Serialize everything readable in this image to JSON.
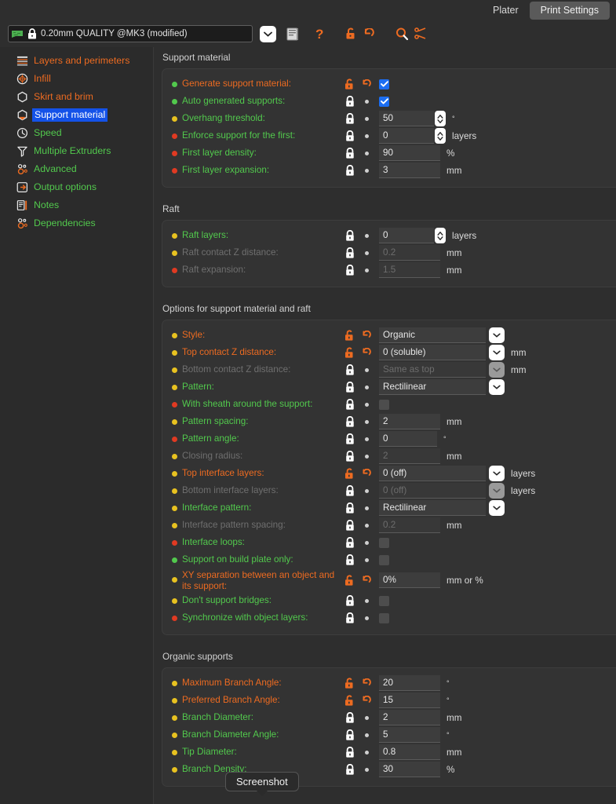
{
  "tabs": [
    {
      "label": "Plater",
      "active": false
    },
    {
      "label": "Print Settings",
      "active": true
    }
  ],
  "toolbar": {
    "preset_value": "0.20mm QUALITY @MK3 (modified)",
    "icons": [
      "printer-flag-icon",
      "lock-icon",
      "chevron-down-icon",
      "save-icon",
      "question-icon",
      "unlock-icon",
      "undo-icon",
      "search-icon",
      "compare-icon"
    ]
  },
  "sidebar": {
    "items": [
      {
        "label": "Layers and perimeters",
        "icon": "layers-icon",
        "color": "#ed6b21",
        "selected": false
      },
      {
        "label": "Infill",
        "icon": "infill-icon",
        "color": "#ed6b21",
        "selected": false
      },
      {
        "label": "Skirt and brim",
        "icon": "skirt-icon",
        "color": "#ed6b21",
        "selected": false
      },
      {
        "label": "Support material",
        "icon": "support-icon",
        "color": "#ffffff",
        "selected": true
      },
      {
        "label": "Speed",
        "icon": "speed-icon",
        "color": "#52c94d",
        "selected": false
      },
      {
        "label": "Multiple Extruders",
        "icon": "extruder-icon",
        "color": "#52c94d",
        "selected": false
      },
      {
        "label": "Advanced",
        "icon": "advanced-icon",
        "color": "#52c94d",
        "selected": false
      },
      {
        "label": "Output options",
        "icon": "output-icon",
        "color": "#52c94d",
        "selected": false
      },
      {
        "label": "Notes",
        "icon": "notes-icon",
        "color": "#52c94d",
        "selected": false
      },
      {
        "label": "Dependencies",
        "icon": "deps-icon",
        "color": "#52c94d",
        "selected": false
      }
    ]
  },
  "sections": [
    {
      "title": "Support material",
      "rows": [
        {
          "label": "Generate support material:",
          "dot": "green",
          "label_color": "orange",
          "modified": true,
          "control": "checkbox",
          "checked": true
        },
        {
          "label": "Auto generated supports:",
          "dot": "green",
          "label_color": "green",
          "modified": false,
          "control": "checkbox",
          "checked": true
        },
        {
          "label": "Overhang threshold:",
          "dot": "yellow",
          "label_color": "green",
          "modified": false,
          "control": "spinner",
          "value": "50",
          "unit": "°",
          "width": "w70"
        },
        {
          "label": "Enforce support for the first:",
          "dot": "red",
          "label_color": "green",
          "modified": false,
          "control": "spinner",
          "value": "0",
          "unit": "layers",
          "width": "w70"
        },
        {
          "label": "First layer density:",
          "dot": "red",
          "label_color": "green",
          "modified": false,
          "control": "text",
          "value": "90",
          "unit": "%",
          "width": "w78"
        },
        {
          "label": "First layer expansion:",
          "dot": "red",
          "label_color": "green",
          "modified": false,
          "control": "text",
          "value": "3",
          "unit": "mm",
          "width": "w78"
        }
      ]
    },
    {
      "title": "Raft",
      "rows": [
        {
          "label": "Raft layers:",
          "dot": "yellow",
          "label_color": "green",
          "modified": false,
          "control": "spinner",
          "value": "0",
          "unit": "layers",
          "width": "w70"
        },
        {
          "label": "Raft contact Z distance:",
          "dot": "yellow",
          "label_color": "green",
          "modified": false,
          "control": "text",
          "value": "0.2",
          "unit": "mm",
          "width": "w78",
          "disabled": true
        },
        {
          "label": "Raft expansion:",
          "dot": "red",
          "label_color": "green",
          "modified": false,
          "control": "text",
          "value": "1.5",
          "unit": "mm",
          "width": "w78",
          "disabled": true
        }
      ]
    },
    {
      "title": "Options for support material and raft",
      "rows": [
        {
          "label": "Style:",
          "dot": "yellow",
          "label_color": "orange",
          "modified": true,
          "control": "dropdown",
          "value": "Organic",
          "unit": "",
          "width": "w136"
        },
        {
          "label": "Top contact Z distance:",
          "dot": "yellow",
          "label_color": "orange",
          "modified": true,
          "control": "dropdown",
          "value": "0 (soluble)",
          "unit": "mm",
          "width": "w136"
        },
        {
          "label": "Bottom contact Z distance:",
          "dot": "yellow",
          "label_color": "green",
          "modified": false,
          "control": "dropdown",
          "value": "Same as top",
          "unit": "mm",
          "width": "w136",
          "disabled": true
        },
        {
          "label": "Pattern:",
          "dot": "yellow",
          "label_color": "green",
          "modified": false,
          "control": "dropdown",
          "value": "Rectilinear",
          "unit": "",
          "width": "w136"
        },
        {
          "label": "With sheath around the support:",
          "dot": "red",
          "label_color": "green",
          "modified": false,
          "control": "checkbox",
          "checked": false
        },
        {
          "label": "Pattern spacing:",
          "dot": "yellow",
          "label_color": "green",
          "modified": false,
          "control": "text",
          "value": "2",
          "unit": "mm",
          "width": "w78"
        },
        {
          "label": "Pattern angle:",
          "dot": "red",
          "label_color": "green",
          "modified": false,
          "control": "text",
          "value": "0",
          "unit": "°",
          "width": "w74"
        },
        {
          "label": "Closing radius:",
          "dot": "yellow",
          "label_color": "green",
          "modified": false,
          "control": "text",
          "value": "2",
          "unit": "mm",
          "width": "w78",
          "disabled": true
        },
        {
          "label": "Top interface layers:",
          "dot": "yellow",
          "label_color": "orange",
          "modified": true,
          "control": "dropdown",
          "value": "0 (off)",
          "unit": "layers",
          "width": "w136"
        },
        {
          "label": "Bottom interface layers:",
          "dot": "yellow",
          "label_color": "green",
          "modified": false,
          "control": "dropdown",
          "value": "0 (off)",
          "unit": "layers",
          "width": "w136",
          "disabled": true
        },
        {
          "label": "Interface pattern:",
          "dot": "yellow",
          "label_color": "green",
          "modified": false,
          "control": "dropdown",
          "value": "Rectilinear",
          "unit": "",
          "width": "w136"
        },
        {
          "label": "Interface pattern spacing:",
          "dot": "yellow",
          "label_color": "green",
          "modified": false,
          "control": "text",
          "value": "0.2",
          "unit": "mm",
          "width": "w78",
          "disabled": true
        },
        {
          "label": "Interface loops:",
          "dot": "red",
          "label_color": "green",
          "modified": false,
          "control": "checkbox",
          "checked": false
        },
        {
          "label": "Support on build plate only:",
          "dot": "green",
          "label_color": "green",
          "modified": false,
          "control": "checkbox",
          "checked": false
        },
        {
          "label": "XY separation between an object and its support:",
          "dot": "yellow",
          "label_color": "orange",
          "modified": true,
          "control": "text",
          "value": "0%",
          "unit": "mm or %",
          "width": "w78",
          "two_line": true
        },
        {
          "label": "Don't support bridges:",
          "dot": "yellow",
          "label_color": "green",
          "modified": false,
          "control": "checkbox",
          "checked": false
        },
        {
          "label": "Synchronize with object layers:",
          "dot": "red",
          "label_color": "green",
          "modified": false,
          "control": "checkbox",
          "checked": false
        }
      ]
    },
    {
      "title": "Organic supports",
      "rows": [
        {
          "label": "Maximum Branch Angle:",
          "dot": "yellow",
          "label_color": "orange",
          "modified": true,
          "control": "text",
          "value": "20",
          "unit": "°",
          "width": "w78"
        },
        {
          "label": "Preferred Branch Angle:",
          "dot": "yellow",
          "label_color": "orange",
          "modified": true,
          "control": "text",
          "value": "15",
          "unit": "°",
          "width": "w78"
        },
        {
          "label": "Branch Diameter:",
          "dot": "yellow",
          "label_color": "green",
          "modified": false,
          "control": "text",
          "value": "2",
          "unit": "mm",
          "width": "w78"
        },
        {
          "label": "Branch Diameter Angle:",
          "dot": "yellow",
          "label_color": "green",
          "modified": false,
          "control": "text",
          "value": "5",
          "unit": "°",
          "width": "w78"
        },
        {
          "label": "Tip Diameter:",
          "dot": "yellow",
          "label_color": "green",
          "modified": false,
          "control": "text",
          "value": "0.8",
          "unit": "mm",
          "width": "w78"
        },
        {
          "label": "Branch Density:",
          "dot": "yellow",
          "label_color": "green",
          "modified": false,
          "control": "text",
          "value": "30",
          "unit": "%",
          "width": "w78"
        }
      ]
    }
  ],
  "tooltip": {
    "text": "Screenshot"
  },
  "colors": {
    "accent": "#ed6b21",
    "green": "#52c94d",
    "yellow": "#e8c220",
    "red": "#e03a22",
    "selection": "#1452e8",
    "window_bg": "#2e2e2e"
  }
}
